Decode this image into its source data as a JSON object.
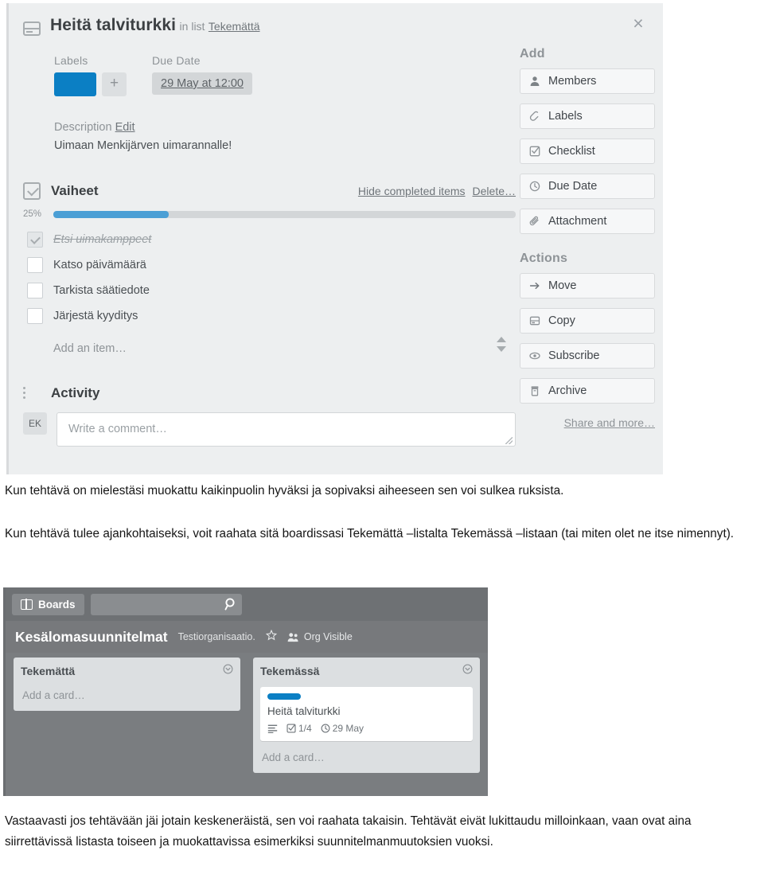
{
  "card_detail": {
    "close_label": "×",
    "card_icon": "card-icon",
    "title": "Heitä talviturkki",
    "in_list_text": "in list",
    "list_name": "Tekemättä",
    "labels_heading": "Labels",
    "label_color": "#0b7fc4",
    "label_add": "+",
    "due_heading": "Due Date",
    "due_value": "29 May at 12:00",
    "description_heading": "Description",
    "description_edit": "Edit",
    "description_body": "Uimaan Menkijärven uimarannalle!",
    "checklist": {
      "title": "Vaiheet",
      "hide_completed": "Hide completed items",
      "delete": "Delete…",
      "progress_percent": "25%",
      "progress_value": 25,
      "items": [
        {
          "text": "Etsi uimakamppeet",
          "done": true
        },
        {
          "text": "Katso päivämäärä",
          "done": false
        },
        {
          "text": "Tarkista säätiedote",
          "done": false
        },
        {
          "text": "Järjestä kyyditys",
          "done": false
        }
      ],
      "add_item_placeholder": "Add an item…"
    },
    "activity": {
      "title": "Activity",
      "avatar_initials": "EK",
      "comment_placeholder": "Write a comment…"
    },
    "sidebar": {
      "add_heading": "Add",
      "add_items": [
        {
          "label": "Members",
          "icon": "member-icon"
        },
        {
          "label": "Labels",
          "icon": "tag-icon"
        },
        {
          "label": "Checklist",
          "icon": "checklist-icon"
        },
        {
          "label": "Due Date",
          "icon": "clock-icon"
        },
        {
          "label": "Attachment",
          "icon": "paperclip-icon"
        }
      ],
      "actions_heading": "Actions",
      "action_items": [
        {
          "label": "Move",
          "icon": "arrow-right-icon"
        },
        {
          "label": "Copy",
          "icon": "copy-icon"
        },
        {
          "label": "Subscribe",
          "icon": "eye-icon"
        },
        {
          "label": "Archive",
          "icon": "archive-icon"
        }
      ],
      "share_more": "Share and more…"
    }
  },
  "paragraphs": {
    "p1": "Kun tehtävä on mielestäsi muokattu kaikinpuolin hyväksi ja sopivaksi aiheeseen sen voi sulkea ruksista.",
    "p2": "Kun tehtävä tulee ajankohtaiseksi, voit raahata sitä boardissasi Tekemättä –listalta Tekemässä –listaan (tai miten olet ne itse nimennyt).",
    "p3": "Vastaavasti jos tehtävään jäi jotain keskeneräistä, sen voi raahata takaisin. Tehtävät eivät lukittaudu milloinkaan, vaan ovat aina siirrettävissä listasta toiseen ja muokattavissa esimerkiksi suunnitelmanmuutoksien vuoksi."
  },
  "board": {
    "boards_button": "Boards",
    "search_placeholder": "",
    "board_name": "Kesälomasuunnitelmat",
    "organization": "Testiorganisaatio.",
    "visibility": "Org Visible",
    "lists": [
      {
        "title": "Tekemättä",
        "add_card": "Add a card…",
        "cards": []
      },
      {
        "title": "Tekemässä",
        "add_card": "Add a card…",
        "cards": [
          {
            "label_color": "#0b7fc4",
            "title": "Heitä talviturkki",
            "checklist_badge": "1/4",
            "due_badge": "29 May"
          }
        ]
      }
    ]
  }
}
